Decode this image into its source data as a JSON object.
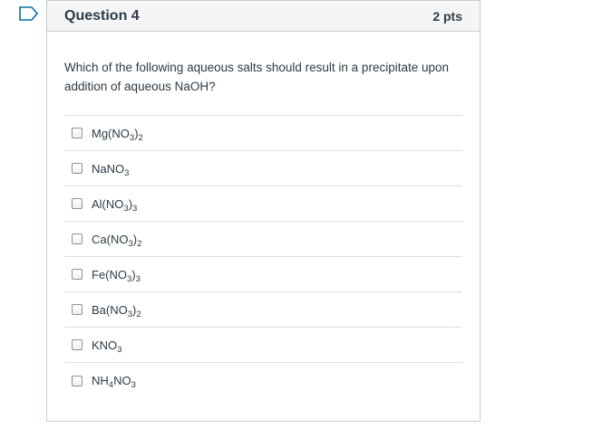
{
  "question": {
    "title": "Question 4",
    "points": "2 pts",
    "text": "Which of the following aqueous salts should result in a precipitate upon addition of aqueous NaOH?"
  },
  "answers": [
    {
      "label": "Mg(NO3)2",
      "parts": [
        [
          "Mg(NO",
          ""
        ],
        [
          "3",
          "sub"
        ],
        [
          ")",
          ""
        ],
        [
          "2",
          "sub"
        ]
      ]
    },
    {
      "label": "NaNO3",
      "parts": [
        [
          "NaNO",
          ""
        ],
        [
          "3",
          "sub"
        ]
      ]
    },
    {
      "label": "Al(NO3)3",
      "parts": [
        [
          "Al(NO",
          ""
        ],
        [
          "3",
          "sub"
        ],
        [
          ")",
          ""
        ],
        [
          "3",
          "sub"
        ]
      ]
    },
    {
      "label": "Ca(NO3)2",
      "parts": [
        [
          "Ca(NO",
          ""
        ],
        [
          "3",
          "sub"
        ],
        [
          ")",
          ""
        ],
        [
          "2",
          "sub"
        ]
      ]
    },
    {
      "label": "Fe(NO3)3",
      "parts": [
        [
          "Fe(NO",
          ""
        ],
        [
          "3",
          "sub"
        ],
        [
          ")",
          ""
        ],
        [
          "3",
          "sub"
        ]
      ]
    },
    {
      "label": "Ba(NO3)2",
      "parts": [
        [
          "Ba(NO",
          ""
        ],
        [
          "3",
          "sub"
        ],
        [
          ")",
          ""
        ],
        [
          "2",
          "sub"
        ]
      ]
    },
    {
      "label": "KNO3",
      "parts": [
        [
          "KNO",
          ""
        ],
        [
          "3",
          "sub"
        ]
      ]
    },
    {
      "label": "NH4NO3",
      "parts": [
        [
          "NH",
          ""
        ],
        [
          "4",
          "sub"
        ],
        [
          "NO",
          ""
        ],
        [
          "3",
          "sub"
        ]
      ]
    }
  ],
  "colors": {
    "flag": "#0770a3",
    "text": "#2d3b45",
    "border": "#c7cdd1",
    "header_bg": "#f5f5f5"
  },
  "icons": {
    "flag": "flag-outline-icon",
    "checkbox": "checkbox-unchecked-icon"
  }
}
